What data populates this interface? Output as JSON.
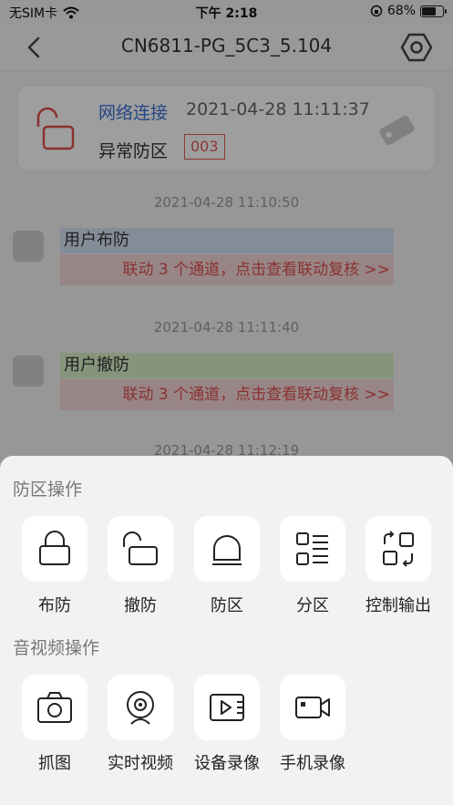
{
  "status_bar": {
    "carrier": "无SIM卡",
    "time": "下午 2:18",
    "battery": "68%",
    "battery_level": 0.68
  },
  "nav": {
    "title": "CN6811-PG_5C3_5.104"
  },
  "card": {
    "net_label": "网络连接",
    "time": "2021-04-28 11:11:37",
    "zone_label": "异常防区",
    "zone_num": "003"
  },
  "events": [
    {
      "time": "2021-04-28 11:10:50",
      "title": "用户布防",
      "title_color": "#d6e2f5",
      "link": "联动 3 个通道，点击查看联动复核 >>"
    },
    {
      "time": "2021-04-28 11:11:40",
      "title": "用户撤防",
      "title_color": "#d9efc9",
      "link": "联动 3 个通道，点击查看联动复核 >>"
    },
    {
      "time": "2021-04-28 11:12:19"
    }
  ],
  "sheet": {
    "zone_section": "防区操作",
    "zone_items": [
      {
        "label": "布防",
        "icon": "lock-closed-icon"
      },
      {
        "label": "撤防",
        "icon": "lock-open-icon"
      },
      {
        "label": "防区",
        "icon": "dome-icon"
      },
      {
        "label": "分区",
        "icon": "partition-list-icon"
      },
      {
        "label": "控制输出",
        "icon": "control-output-icon"
      }
    ],
    "av_section": "音视频操作",
    "av_items": [
      {
        "label": "抓图",
        "icon": "camera-icon"
      },
      {
        "label": "实时视频",
        "icon": "webcam-icon"
      },
      {
        "label": "设备录像",
        "icon": "device-video-icon"
      },
      {
        "label": "手机录像",
        "icon": "phone-video-icon"
      }
    ]
  }
}
